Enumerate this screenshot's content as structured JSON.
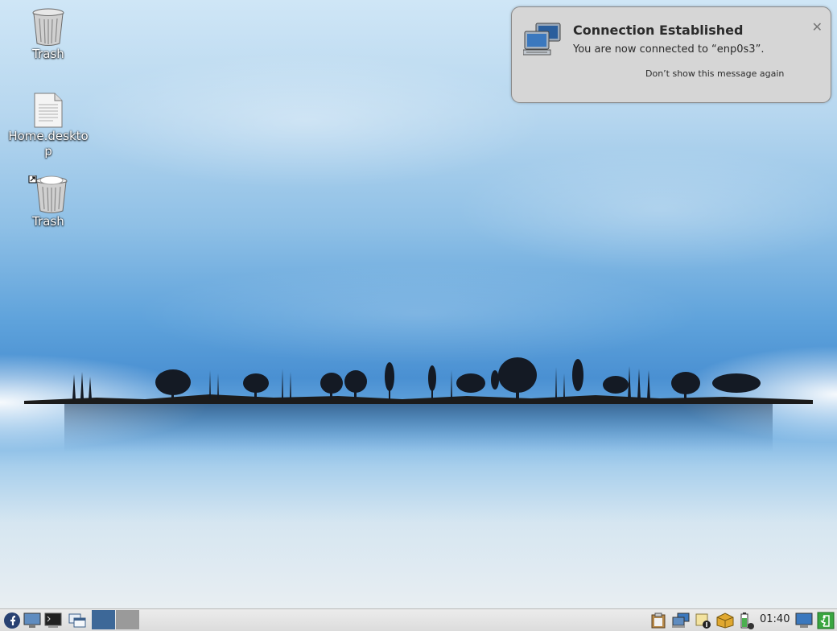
{
  "desktop": {
    "icons": [
      {
        "label": "Trash",
        "icon": "trash-icon"
      },
      {
        "label": "Home.desktop",
        "icon": "text-file-icon"
      },
      {
        "label": "Trash",
        "icon": "trash-full-icon"
      }
    ]
  },
  "notification": {
    "title": "Connection Established",
    "body": "You are now connected to “enp0s3”.",
    "action": "Don’t show this message again",
    "close": "✕",
    "icon": "network-computers-icon"
  },
  "taskbar": {
    "left": [
      "fedora-menu-icon",
      "show-desktop-icon",
      "terminal-icon",
      "window-switcher-icon",
      "workspace-1",
      "workspace-2"
    ],
    "tray": [
      "clipboard-icon",
      "network-icon",
      "updates-icon",
      "package-icon",
      "battery-icon",
      "display-icon",
      "logout-icon"
    ],
    "clock": "01:40",
    "colors": {
      "workspace_active": "#3d6898",
      "workspace_inactive": "#9a9a9a",
      "logout": "#3aa640"
    }
  }
}
